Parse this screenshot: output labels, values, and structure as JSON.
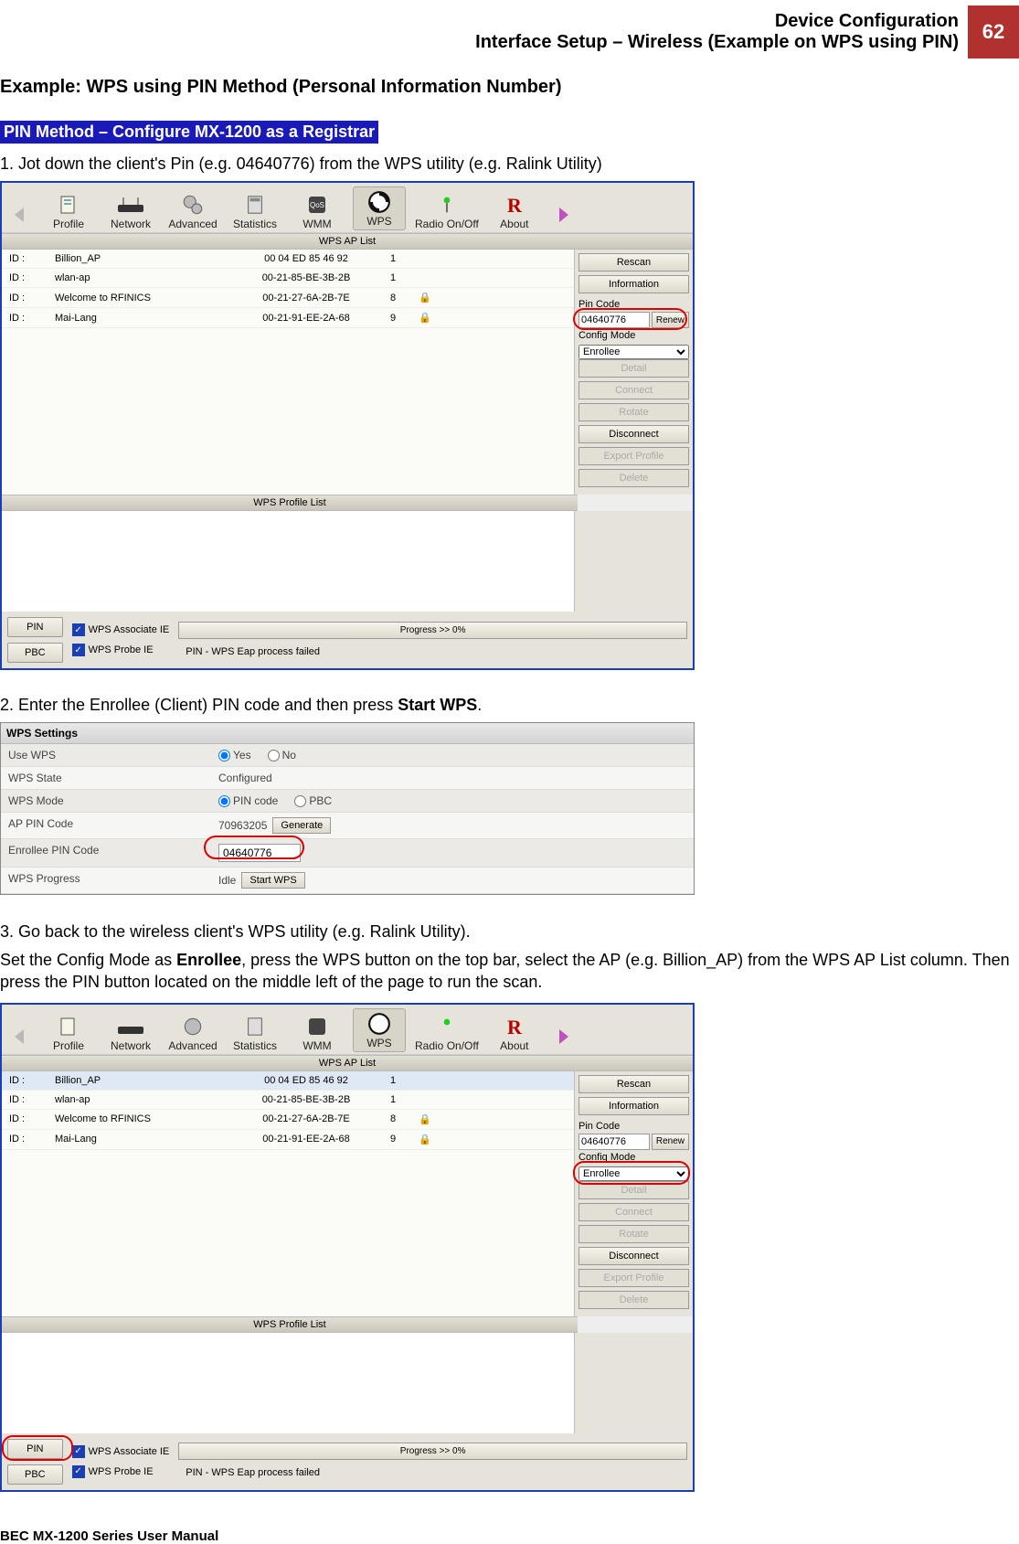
{
  "header": {
    "line1": "Device Configuration",
    "line2": "Interface Setup – Wireless (Example on WPS using PIN)",
    "page_num": "62"
  },
  "title": "Example: WPS using PIN Method (Personal Information Number)",
  "section_bar": "PIN Method – Configure MX-1200 as a Registrar",
  "step1": "1.  Jot down the client's Pin (e.g. 04640776) from the WPS utility (e.g. Ralink Utility)",
  "step2_pre": "2.  Enter the Enrollee (Client) PIN code and then press ",
  "step2_bold": "Start WPS",
  "step2_post": ".",
  "step3": "3.  Go back to the wireless client's WPS utility (e.g. Ralink Utility).",
  "step3_desc_a": "Set the Config Mode as ",
  "step3_desc_bold": "Enrollee",
  "step3_desc_b": ", press the WPS button on the top bar, select the AP (e.g. Billion_AP) from the WPS AP List column. Then press the PIN button located on the middle left of the page to run the scan.",
  "toolbar": {
    "profile": "Profile",
    "network": "Network",
    "advanced": "Advanced",
    "statistics": "Statistics",
    "wmm": "WMM",
    "wps": "WPS",
    "radio": "Radio On/Off",
    "about": "About"
  },
  "ralink": {
    "ap_list_header": "WPS AP List",
    "profile_list_header": "WPS Profile List",
    "rows": [
      {
        "id": "ID :",
        "ssid": "Billion_AP",
        "mac": "00 04 ED 85 46 92",
        "ch": "1",
        "sec": ""
      },
      {
        "id": "ID :",
        "ssid": "wlan-ap",
        "mac": "00-21-85-BE-3B-2B",
        "ch": "1",
        "sec": ""
      },
      {
        "id": "ID :",
        "ssid": "Welcome to RFINICS",
        "mac": "00-21-27-6A-2B-7E",
        "ch": "8",
        "sec": "🔒"
      },
      {
        "id": "ID :",
        "ssid": "Mai-Lang",
        "mac": "00-21-91-EE-2A-68",
        "ch": "9",
        "sec": "🔒"
      }
    ],
    "side": {
      "rescan": "Rescan",
      "information": "Information",
      "pin_code": "Pin Code",
      "pin_value": "04640776",
      "renew": "Renew",
      "config_mode": "Config Mode",
      "config_value": "Enrollee",
      "detail": "Detail",
      "connect": "Connect",
      "rotate": "Rotate",
      "disconnect": "Disconnect",
      "export": "Export Profile",
      "delete": "Delete"
    },
    "bottom": {
      "pin_btn": "PIN",
      "pbc_btn": "PBC",
      "assoc_ie": "WPS Associate IE",
      "probe_ie": "WPS Probe IE",
      "progress": "Progress >> 0%",
      "status": "PIN - WPS Eap process failed"
    }
  },
  "wps_settings": {
    "title": "WPS Settings",
    "use_wps": "Use WPS",
    "yes": "Yes",
    "no": "No",
    "wps_state": "WPS State",
    "configured": "Configured",
    "wps_mode": "WPS Mode",
    "pin_code_opt": "PIN code",
    "pbc_opt": "PBC",
    "ap_pin": "AP PIN Code",
    "ap_pin_val": "70963205",
    "generate": "Generate",
    "enrollee_pin": "Enrollee PIN Code",
    "enrollee_pin_val": "04640776",
    "wps_progress": "WPS Progress",
    "idle": "Idle",
    "start_wps": "Start WPS"
  },
  "footer": "BEC MX-1200 Series User Manual"
}
